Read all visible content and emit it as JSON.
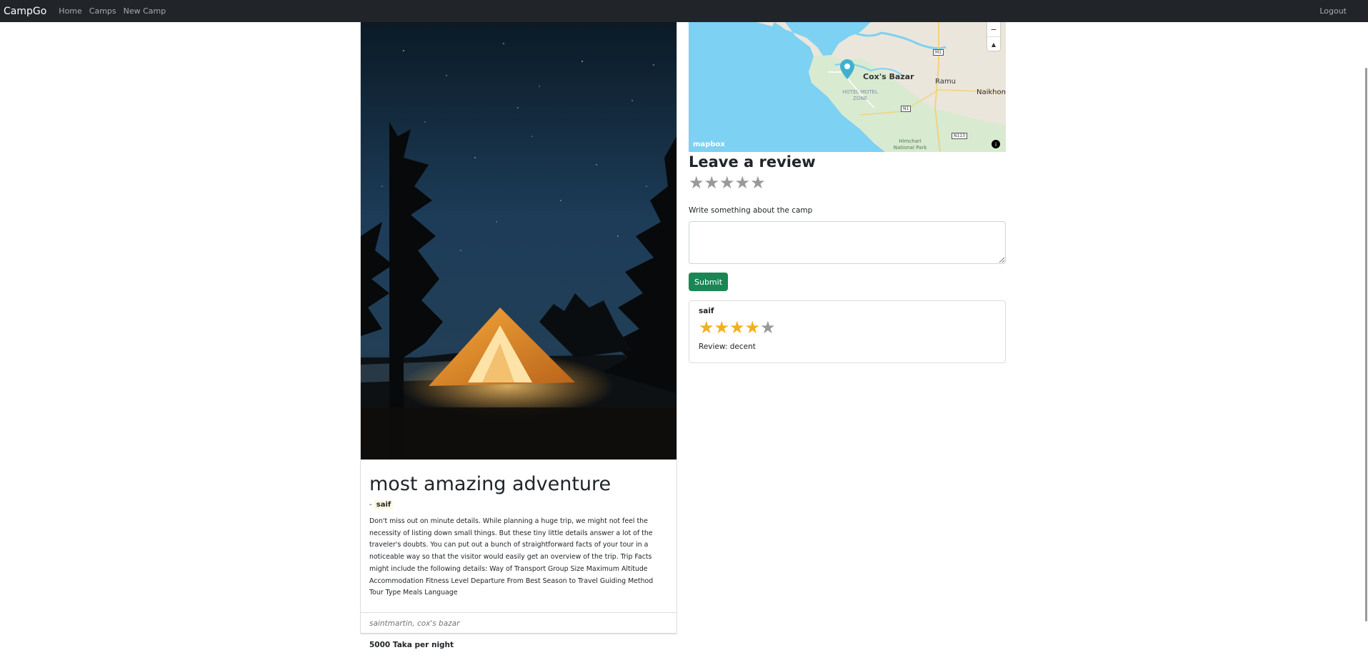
{
  "navbar": {
    "brand": "CampGo",
    "links": [
      "Home",
      "Camps",
      "New Camp"
    ],
    "logout": "Logout"
  },
  "camp": {
    "title": "most amazing adventure",
    "author_prefix": "-",
    "author": "saif",
    "description": "Don't miss out on minute details. While planning a huge trip, we might not feel the necessity of listing down small things. But these tiny little details answer a lot of the traveler's doubts. You can put out a bunch of straightforward facts of your tour in a noticeable way so that the visitor would easily get an overview of the trip. Trip Facts might include the following details: Way of Transport Group Size Maximum Altitude Accommodation Fitness Level Departure From Best Season to Travel Guiding Method Tour Type Meals Language",
    "location": "saintmartin, cox's bazar",
    "price": "5000 Taka per night"
  },
  "map": {
    "zoom_out": "−",
    "compass": "▲",
    "labels": {
      "city": "Cox's Bazar",
      "ramu": "Ramu",
      "naikhong": "Naikhong",
      "hotel_zone": "HOTEL MOTEL ZONE",
      "himchari": "Himchari National Park",
      "m1": "M1",
      "n1": "N1",
      "n113": "N113"
    },
    "attribution": "mapbox",
    "info": "i"
  },
  "review_form": {
    "heading": "Leave a review",
    "star_glyph": "★",
    "label": "Write something about the camp",
    "textarea_value": "",
    "submit": "Submit"
  },
  "reviews": [
    {
      "author": "saif",
      "rating": 4,
      "text": "Review: decent"
    }
  ],
  "colors": {
    "navbar_bg": "#212529",
    "success": "#198754",
    "star_filled": "#f2b01e",
    "star_empty": "#999999",
    "water": "#7dd1f2",
    "land": "#eae6dc"
  }
}
